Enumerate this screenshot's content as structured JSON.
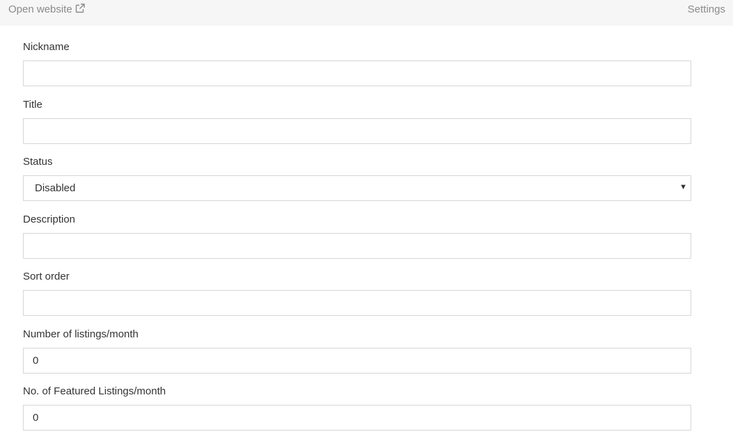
{
  "topbar": {
    "open_website_label": "Open website",
    "open_website_icon": "external-link-icon",
    "settings_label": "Settings"
  },
  "form": {
    "nickname": {
      "label": "Nickname",
      "value": "",
      "placeholder": ""
    },
    "title": {
      "label": "Title",
      "value": "",
      "placeholder": ""
    },
    "status": {
      "label": "Status",
      "selected": "Disabled",
      "caret_icon": "caret-down-icon"
    },
    "description": {
      "label": "Description",
      "value": "",
      "placeholder": ""
    },
    "sort_order": {
      "label": "Sort order",
      "value": "",
      "placeholder": ""
    },
    "listings_per_month": {
      "label": "Number of listings/month",
      "value": "0"
    },
    "featured_per_month": {
      "label": "No. of Featured Listings/month",
      "value": "0"
    }
  },
  "colors": {
    "topbar_bg": "#f6f6f7",
    "muted_text": "#8a8a8a",
    "input_border": "#d6d6d6",
    "text": "#333333"
  }
}
